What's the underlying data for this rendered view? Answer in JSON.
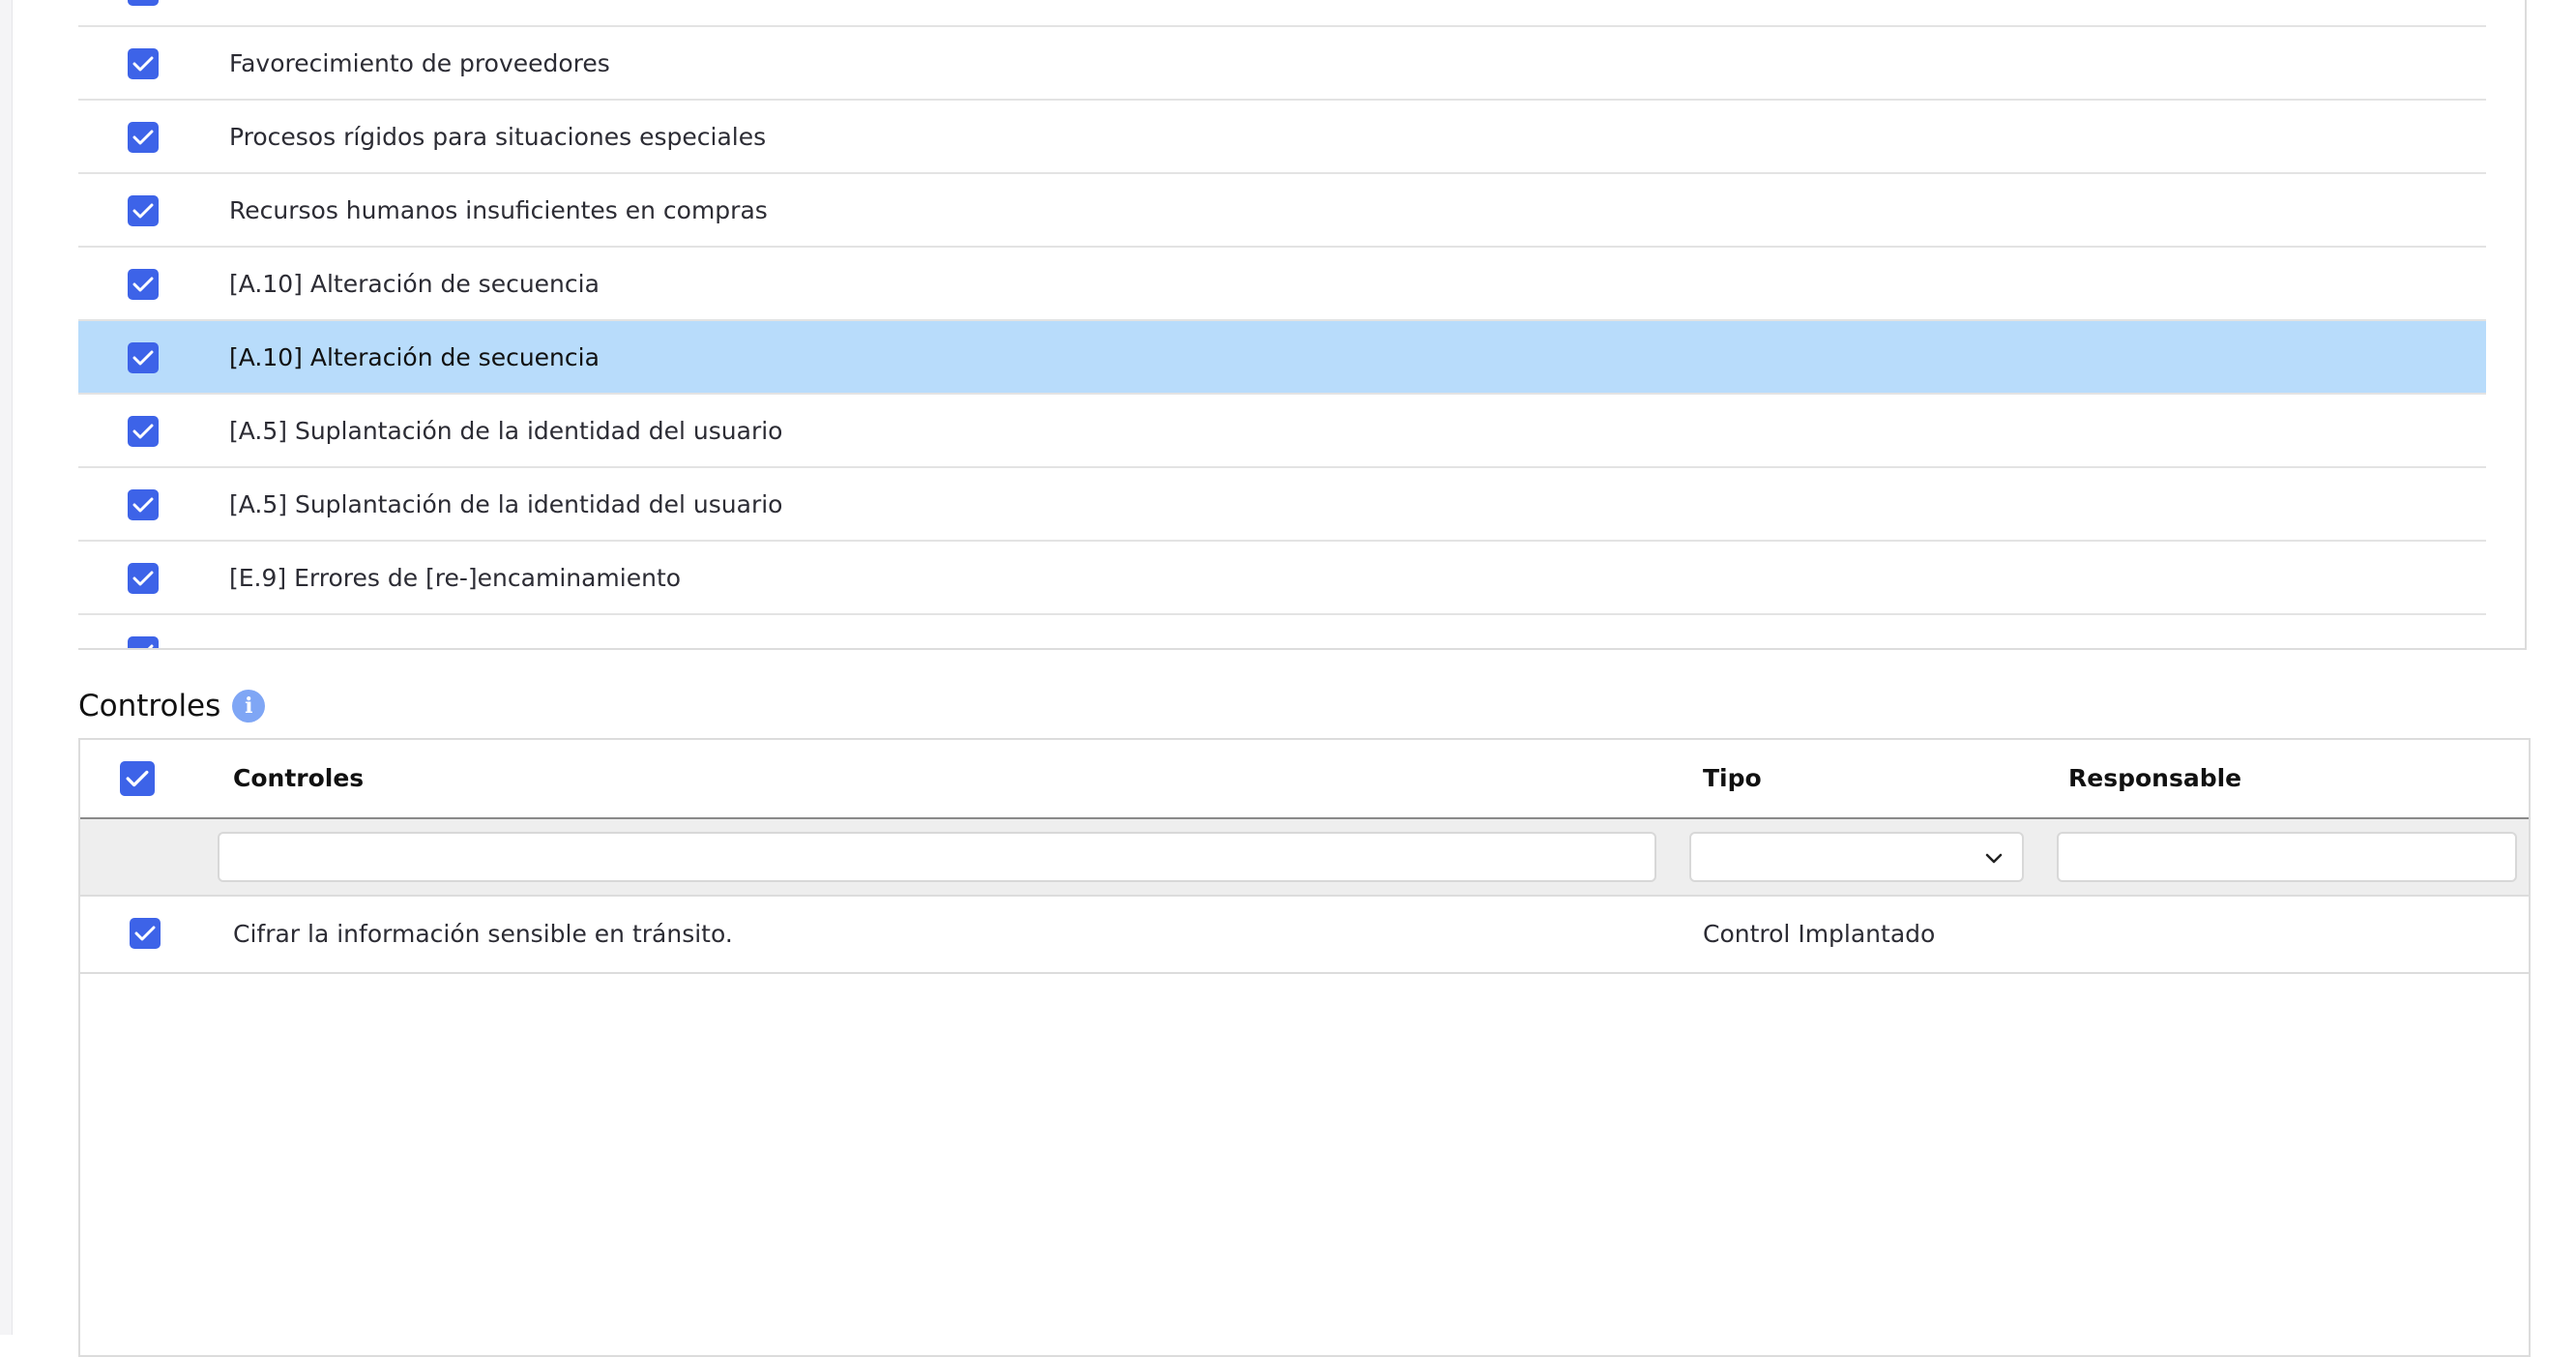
{
  "threats": {
    "items": [
      {
        "label": "",
        "checked": true
      },
      {
        "label": "Favorecimiento de proveedores",
        "checked": true
      },
      {
        "label": "Procesos rígidos para situaciones especiales",
        "checked": true
      },
      {
        "label": "Recursos humanos insuficientes en compras",
        "checked": true
      },
      {
        "label": "[A.10] Alteración de secuencia",
        "checked": true
      },
      {
        "label": "[A.10] Alteración de secuencia",
        "checked": true,
        "selected": true
      },
      {
        "label": "[A.5] Suplantación de la identidad del usuario",
        "checked": true
      },
      {
        "label": "[A.5] Suplantación de la identidad del usuario",
        "checked": true
      },
      {
        "label": "[E.9] Errores de [re-]encaminamiento",
        "checked": true
      },
      {
        "label": "",
        "checked": true
      }
    ]
  },
  "controls": {
    "section_title": "Controles",
    "info_icon": "info-icon",
    "columns": {
      "controls": "Controles",
      "type": "Tipo",
      "responsible": "Responsable"
    },
    "filters": {
      "controls": "",
      "type": "",
      "responsible": ""
    },
    "rows": [
      {
        "control": "Cifrar la información sensible en tránsito.",
        "type": "Control Implantado",
        "responsible": "",
        "checked": true
      }
    ]
  },
  "colors": {
    "checkbox": "#3d63e8",
    "selected_row": "#b8dcfb",
    "info_icon": "#7fa6f5",
    "filter_bg": "#eeeeee"
  }
}
